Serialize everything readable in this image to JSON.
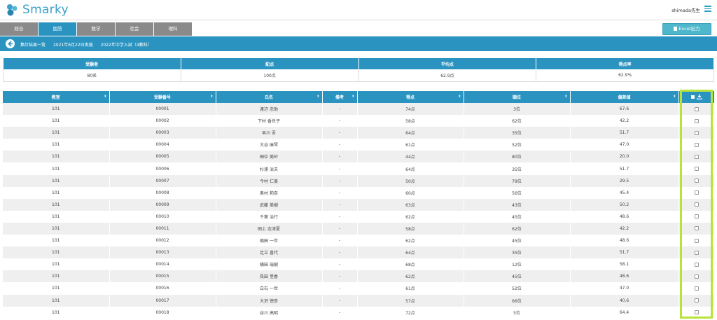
{
  "app": {
    "logo_text": "Smarky",
    "user_label": "shimada先生"
  },
  "tabs": [
    {
      "label": "総合"
    },
    {
      "label": "国語"
    },
    {
      "label": "数学"
    },
    {
      "label": "社会"
    },
    {
      "label": "理科"
    }
  ],
  "excel_button": {
    "label": "Excel出力"
  },
  "breadcrumb": {
    "page": "集計結果一覧",
    "date": "2021年6月22日実施",
    "exam": "2022年中学入試（4教科）"
  },
  "summary": {
    "headers": [
      "受験者",
      "配点",
      "平均点",
      "得点率"
    ],
    "values": [
      "80名",
      "100点",
      "62.9点",
      "62.9%"
    ]
  },
  "table": {
    "headers": [
      "教室",
      "受験番号",
      "氏名",
      "備考",
      "得点",
      "順位",
      "偏差値"
    ],
    "rows": [
      [
        "101",
        "00001",
        "渡辺 忠助",
        "-",
        "74点",
        "3位",
        "67.6"
      ],
      [
        "101",
        "00002",
        "下村 香世子",
        "-",
        "58点",
        "62位",
        "42.2"
      ],
      [
        "101",
        "00003",
        "早川 吾",
        "-",
        "64点",
        "35位",
        "51.7"
      ],
      [
        "101",
        "00004",
        "大谷 麻琴",
        "-",
        "61点",
        "52位",
        "47.0"
      ],
      [
        "101",
        "00005",
        "田中 美紗",
        "-",
        "44点",
        "80位",
        "20.0"
      ],
      [
        "101",
        "00006",
        "杉浦 治夫",
        "-",
        "64点",
        "35位",
        "51.7"
      ],
      [
        "101",
        "00007",
        "今村 仁美",
        "-",
        "50点",
        "79位",
        "29.5"
      ],
      [
        "101",
        "00008",
        "奥村 莉奈",
        "-",
        "60点",
        "56位",
        "45.4"
      ],
      [
        "101",
        "00009",
        "武藤 美樹",
        "-",
        "63点",
        "43位",
        "50.2"
      ],
      [
        "101",
        "00010",
        "千葉 治行",
        "-",
        "62点",
        "45位",
        "48.6"
      ],
      [
        "101",
        "00011",
        "田上 志津夏",
        "-",
        "58点",
        "62位",
        "42.2"
      ],
      [
        "101",
        "00012",
        "嶋田 一世",
        "-",
        "62点",
        "45位",
        "48.6"
      ],
      [
        "101",
        "00013",
        "足立 喜代",
        "-",
        "64点",
        "35位",
        "51.7"
      ],
      [
        "101",
        "00014",
        "横田 瑞樹",
        "-",
        "68点",
        "12位",
        "58.1"
      ],
      [
        "101",
        "00015",
        "長田 里香",
        "-",
        "62点",
        "45位",
        "48.6"
      ],
      [
        "101",
        "00016",
        "白石 一世",
        "-",
        "61点",
        "52位",
        "47.0"
      ],
      [
        "101",
        "00017",
        "大沢 徳彦",
        "-",
        "57点",
        "66位",
        "40.6"
      ],
      [
        "101",
        "00018",
        "谷川 高昭",
        "-",
        "72点",
        "5位",
        "64.4"
      ]
    ]
  },
  "colors": {
    "primary": "#2b93c0",
    "tab_inactive": "#8a8a8a",
    "excel": "#4fb7cc",
    "highlight": "#b7e33a"
  }
}
